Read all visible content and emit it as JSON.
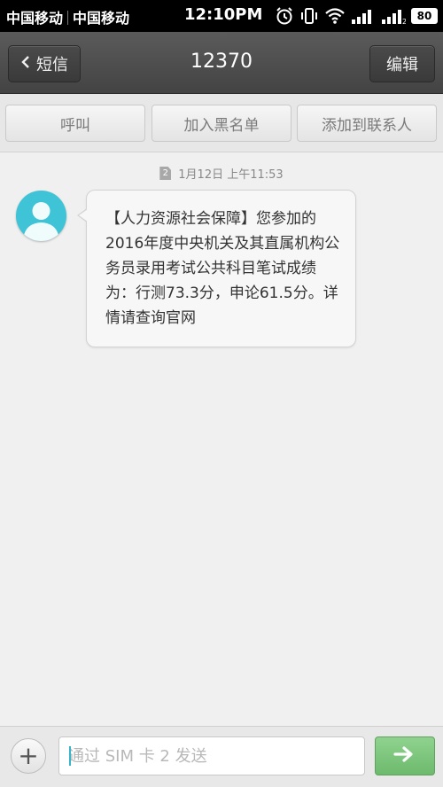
{
  "status_bar": {
    "carrier_1": "中国移动",
    "carrier_2": "中国移动",
    "time": "12:10PM",
    "battery": "80",
    "icons": [
      "alarm-icon",
      "vibrate-icon",
      "wifi-icon",
      "signal-icon",
      "signal-icon-sim2",
      "battery-icon"
    ]
  },
  "header": {
    "back_label": "短信",
    "title": "12370",
    "edit_label": "编辑"
  },
  "actions": {
    "call": "呼叫",
    "blacklist": "加入黑名单",
    "add_contact": "添加到联系人"
  },
  "conversation": {
    "sim_badge": "2",
    "timestamp": "1月12日 上午11:53",
    "message": "【人力资源社会保障】您参加的2016年度中央机关及其直属机构公务员录用考试公共科目笔试成绩为：行测73.3分，申论61.5分。详情请查询官网"
  },
  "compose": {
    "placeholder": "通过 SIM 卡 2 发送",
    "value": ""
  },
  "colors": {
    "avatar_bg": "#3ec4d6",
    "send_button": "#7cc67c",
    "header_bg": "#4d4d4d"
  }
}
